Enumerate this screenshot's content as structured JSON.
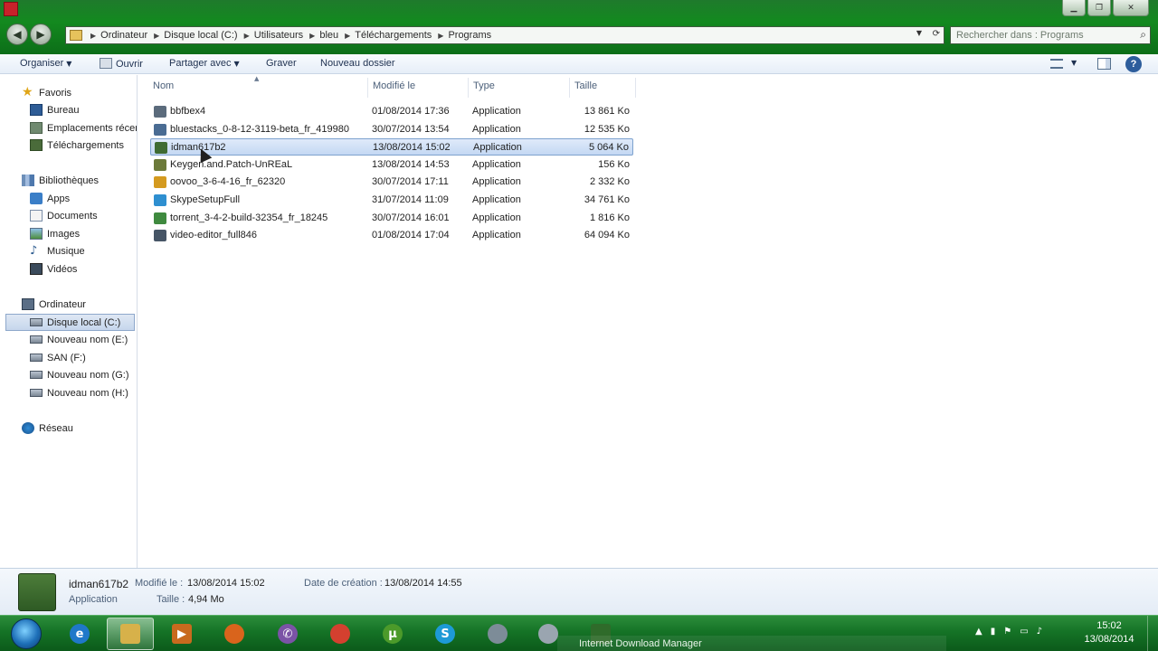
{
  "address": {
    "crumbs": [
      "Ordinateur",
      "Disque local (C:)",
      "Utilisateurs",
      "bleu",
      "Téléchargements",
      "Programs"
    ],
    "search_placeholder": "Rechercher dans : Programs"
  },
  "toolbar": {
    "organize": "Organiser",
    "open": "Ouvrir",
    "share": "Partager avec",
    "burn": "Graver",
    "new_folder": "Nouveau dossier"
  },
  "nav": {
    "favorites": "Favoris",
    "desktop": "Bureau",
    "recent": "Emplacements récents",
    "downloads": "Téléchargements",
    "libraries": "Bibliothèques",
    "apps": "Apps",
    "documents": "Documents",
    "images": "Images",
    "music": "Musique",
    "videos": "Vidéos",
    "computer": "Ordinateur",
    "drives": [
      "Disque local (C:)",
      "Nouveau nom (E:)",
      "SAN (F:)",
      "Nouveau nom (G:)",
      "Nouveau nom (H:)"
    ],
    "network": "Réseau"
  },
  "columns": {
    "name": "Nom",
    "modified": "Modifié le",
    "type": "Type",
    "size": "Taille"
  },
  "files": [
    {
      "name": "bbfbex4",
      "date": "01/08/2014 17:36",
      "type": "Application",
      "size": "13 861 Ko",
      "icon_color": "#5b6b7c"
    },
    {
      "name": "bluestacks_0-8-12-3119-beta_fr_419980",
      "date": "30/07/2014 13:54",
      "type": "Application",
      "size": "12 535 Ko",
      "icon_color": "#4a6c93"
    },
    {
      "name": "idman617b2",
      "date": "13/08/2014 15:02",
      "type": "Application",
      "size": "5 064 Ko",
      "icon_color": "#3f6b33"
    },
    {
      "name": "Keygen.and.Patch-UnREaL",
      "date": "13/08/2014 14:53",
      "type": "Application",
      "size": "156 Ko",
      "icon_color": "#6c7a3a"
    },
    {
      "name": "oovoo_3-6-4-16_fr_62320",
      "date": "30/07/2014 17:11",
      "type": "Application",
      "size": "2 332 Ko",
      "icon_color": "#d49a1f"
    },
    {
      "name": "SkypeSetupFull",
      "date": "31/07/2014 11:09",
      "type": "Application",
      "size": "34 761 Ko",
      "icon_color": "#2e8fd0"
    },
    {
      "name": "torrent_3-4-2-build-32354_fr_18245",
      "date": "30/07/2014 16:01",
      "type": "Application",
      "size": "1 816 Ko",
      "icon_color": "#3f8a3f"
    },
    {
      "name": "video-editor_full846",
      "date": "01/08/2014 17:04",
      "type": "Application",
      "size": "64 094 Ko",
      "icon_color": "#465566"
    }
  ],
  "details": {
    "name": "idman617b2",
    "type": "Application",
    "modified_label": "Modifié le :",
    "modified_value": "13/08/2014 15:02",
    "created_label": "Date de création :",
    "created_value": "13/08/2014 14:55",
    "size_label": "Taille :",
    "size_value": "4,94 Mo"
  },
  "taskbar": {
    "window_label": "Internet Download Manager",
    "time": "15:02",
    "date": "13/08/2014"
  }
}
